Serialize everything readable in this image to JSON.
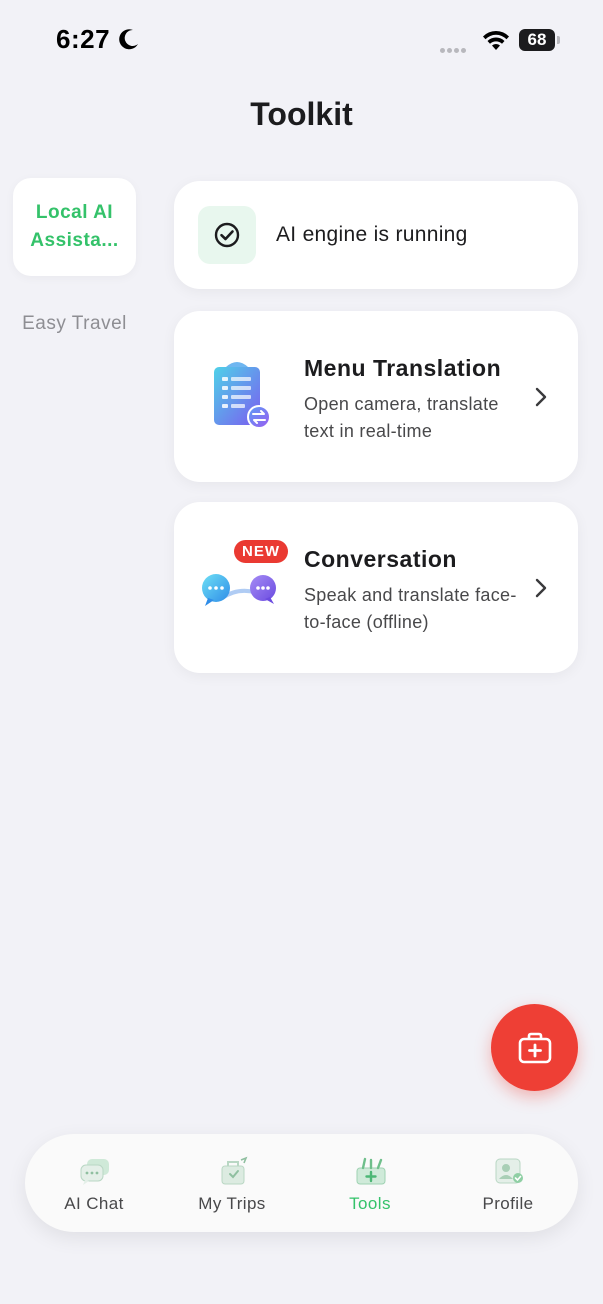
{
  "status_bar": {
    "time": "6:27",
    "battery": "68"
  },
  "header": {
    "title": "Toolkit"
  },
  "side_menu": {
    "items": [
      {
        "label": "Local AI Assista...",
        "active": true
      },
      {
        "label": "Easy Travel",
        "active": false
      }
    ]
  },
  "status_card": {
    "text": "AI engine is running",
    "icon": "check-circle-icon"
  },
  "tools": [
    {
      "title": "Menu Translation",
      "description": "Open camera, translate text in real-time",
      "icon": "menu-translation-icon"
    },
    {
      "title": "Conversation",
      "description": "Speak and translate face-to-face (offline)",
      "icon": "conversation-icon",
      "badge": "NEW"
    }
  ],
  "fab": {
    "icon": "first-aid-kit-icon"
  },
  "tab_bar": {
    "items": [
      {
        "label": "AI Chat",
        "icon": "chat-bubbles-icon",
        "active": false
      },
      {
        "label": "My Trips",
        "icon": "suitcase-icon",
        "active": false
      },
      {
        "label": "Tools",
        "icon": "toolbox-icon",
        "active": true
      },
      {
        "label": "Profile",
        "icon": "profile-card-icon",
        "active": false
      }
    ]
  },
  "colors": {
    "accent_green": "#34c26a",
    "badge_red": "#ea3a32",
    "fab_red": "#ee3f35",
    "background": "#f2f2f7"
  }
}
